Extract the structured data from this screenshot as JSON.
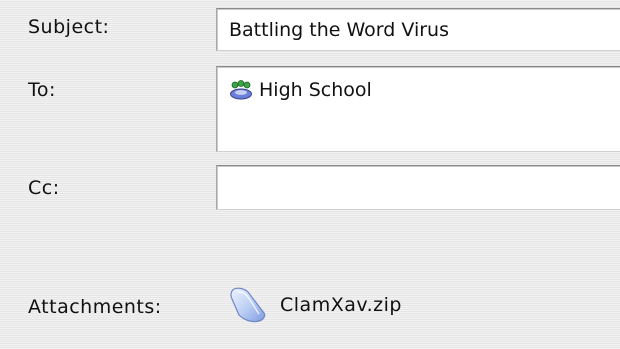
{
  "header": {
    "subject_label": "Subject:",
    "subject_value": "Battling the Word Virus",
    "to_label": "To:",
    "to_recipients": [
      {
        "name": "High School",
        "icon": "group-icon"
      }
    ],
    "cc_label": "Cc:",
    "cc_value": ""
  },
  "attachments": {
    "label": "Attachments:",
    "files": [
      {
        "name": "ClamXav.zip",
        "icon": "zip-file-icon"
      }
    ]
  },
  "colors": {
    "background": "#ececec",
    "field_background": "#ffffff",
    "field_border": "#8a8a8a",
    "file_icon": "#a9c4f0"
  }
}
